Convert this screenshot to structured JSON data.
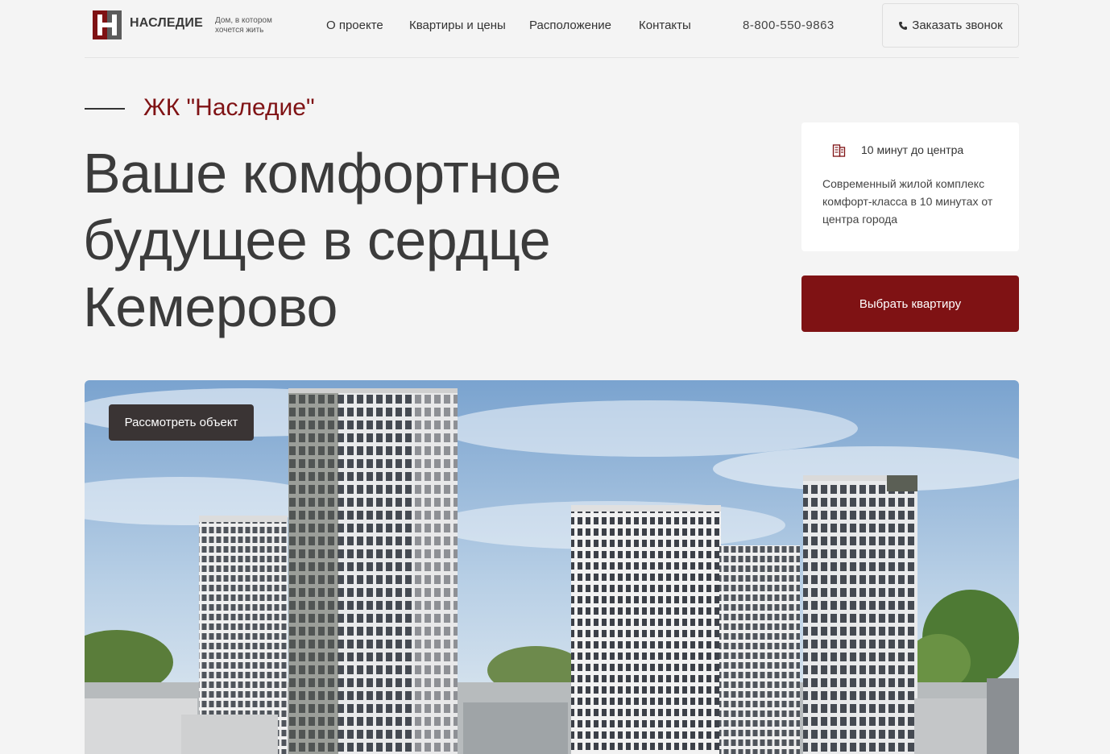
{
  "header": {
    "brand_name": "НАСЛЕДИЕ",
    "tagline": "Дом, в котором хочется жить",
    "nav": [
      {
        "label": "О проекте"
      },
      {
        "label": "Квартиры и цены"
      },
      {
        "label": "Расположение"
      },
      {
        "label": "Контакты"
      }
    ],
    "phone": "8-800-550-9863",
    "callback_label": "Заказать звонок",
    "callback_icon": "phone-icon"
  },
  "hero": {
    "eyebrow": "ЖК \"Наследие\"",
    "title": "Ваше комфортное будущее в сердце Кемерово",
    "card": {
      "icon": "building-icon",
      "title": "10 минут до центра",
      "text": "Современный жилой комплекс комфорт-класса в 10 минутах от центра города"
    },
    "primary_button": "Выбрать квартиру",
    "view_button": "Рассмотреть объект"
  },
  "colors": {
    "brand": "#7f1214",
    "background": "#f4f4f4",
    "dark_button": "#3a3434"
  }
}
